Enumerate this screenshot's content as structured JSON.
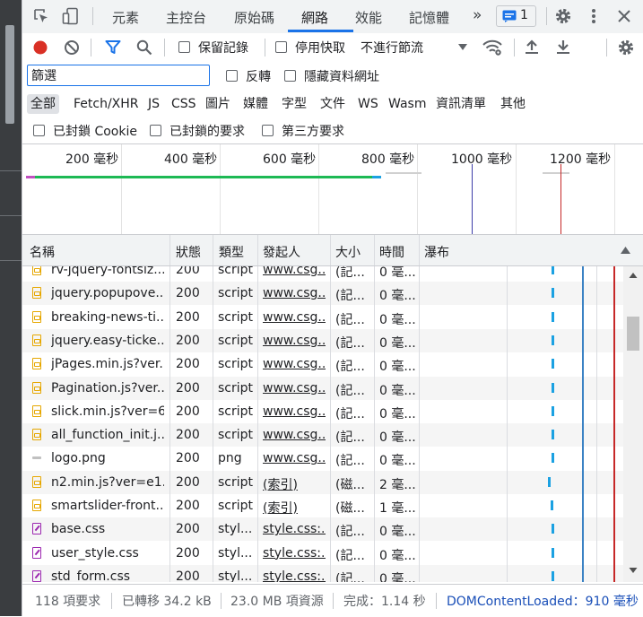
{
  "tabs": {
    "items": [
      "元素",
      "主控台",
      "原始碼",
      "網路",
      "效能",
      "記憶體"
    ],
    "overflow": "»",
    "issues_count": "1"
  },
  "toolbar": {
    "preserve_log_label": "保留記錄",
    "disable_cache_label": "停用快取",
    "throttling_value": "不進行節流"
  },
  "filter": {
    "value": "篩選",
    "invert_label": "反轉",
    "hide_data_urls_label": "隱藏資料網址"
  },
  "resource_types": [
    "全部",
    "Fetch/XHR",
    "JS",
    "CSS",
    "圖片",
    "媒體",
    "字型",
    "文件",
    "WS",
    "Wasm",
    "資訊清單",
    "其他"
  ],
  "blocked": {
    "blocked_cookies_label": "已封鎖 Cookie",
    "blocked_requests_label": "已封鎖的要求",
    "third_party_label": "第三方要求"
  },
  "overview": {
    "ticks": [
      "200 毫秒",
      "400 毫秒",
      "600 毫秒",
      "800 毫秒",
      "1000 毫秒",
      "1200 毫秒"
    ]
  },
  "table": {
    "columns": [
      "名稱",
      "狀態",
      "類型",
      "發起人",
      "大小",
      "時間",
      "瀑布"
    ],
    "rows": [
      {
        "name": "rv-jquery-fontsiz...",
        "status": "200",
        "type": "script",
        "initiator": "www.csg...",
        "size": "(記...",
        "time": "0 毫...",
        "icon": "js"
      },
      {
        "name": "jquery.popupove...",
        "status": "200",
        "type": "script",
        "initiator": "www.csg...",
        "size": "(記...",
        "time": "0 毫...",
        "icon": "js"
      },
      {
        "name": "breaking-news-ti...",
        "status": "200",
        "type": "script",
        "initiator": "www.csg...",
        "size": "(記...",
        "time": "0 毫...",
        "icon": "js"
      },
      {
        "name": "jquery.easy-ticke...",
        "status": "200",
        "type": "script",
        "initiator": "www.csg...",
        "size": "(記...",
        "time": "0 毫...",
        "icon": "js"
      },
      {
        "name": "jPages.min.js?ver...",
        "status": "200",
        "type": "script",
        "initiator": "www.csg...",
        "size": "(記...",
        "time": "0 毫...",
        "icon": "js"
      },
      {
        "name": "Pagination.js?ver...",
        "status": "200",
        "type": "script",
        "initiator": "www.csg...",
        "size": "(記...",
        "time": "0 毫...",
        "icon": "js"
      },
      {
        "name": "slick.min.js?ver=6...",
        "status": "200",
        "type": "script",
        "initiator": "www.csg...",
        "size": "(記...",
        "time": "0 毫...",
        "icon": "js"
      },
      {
        "name": "all_function_init.j...",
        "status": "200",
        "type": "script",
        "initiator": "www.csg...",
        "size": "(記...",
        "time": "0 毫...",
        "icon": "js"
      },
      {
        "name": "logo.png",
        "status": "200",
        "type": "png",
        "initiator": "www.csg...",
        "size": "(記...",
        "time": "0 毫...",
        "icon": "img"
      },
      {
        "name": "n2.min.js?ver=e1...",
        "status": "200",
        "type": "script",
        "initiator": "(索引)",
        "size": "(磁...",
        "time": "2 毫...",
        "icon": "js"
      },
      {
        "name": "smartslider-front...",
        "status": "200",
        "type": "script",
        "initiator": "(索引)",
        "size": "(磁...",
        "time": "1 毫...",
        "icon": "js"
      },
      {
        "name": "base.css",
        "status": "200",
        "type": "styl...",
        "initiator": "style.css:...",
        "size": "(記...",
        "time": "0 毫...",
        "icon": "css"
      },
      {
        "name": "user_style.css",
        "status": "200",
        "type": "styl...",
        "initiator": "style.css:...",
        "size": "(記...",
        "time": "0 毫...",
        "icon": "css"
      },
      {
        "name": "std_form.css",
        "status": "200",
        "type": "styl...",
        "initiator": "style.css:...",
        "size": "(記...",
        "time": "0 毫...",
        "icon": "css"
      }
    ]
  },
  "status_bar": {
    "requests": "118 項要求",
    "transferred": "已轉移 34.2 kB",
    "resources": "23.0 MB 項資源",
    "finish": "完成：1.14 秒",
    "dom_content_loaded": "DOMContentLoaded：910 毫秒"
  },
  "colors": {
    "accent": "#1a73e8",
    "record": "#d93025",
    "dom_line": "#3c3ca8",
    "load_line": "#c62828"
  }
}
